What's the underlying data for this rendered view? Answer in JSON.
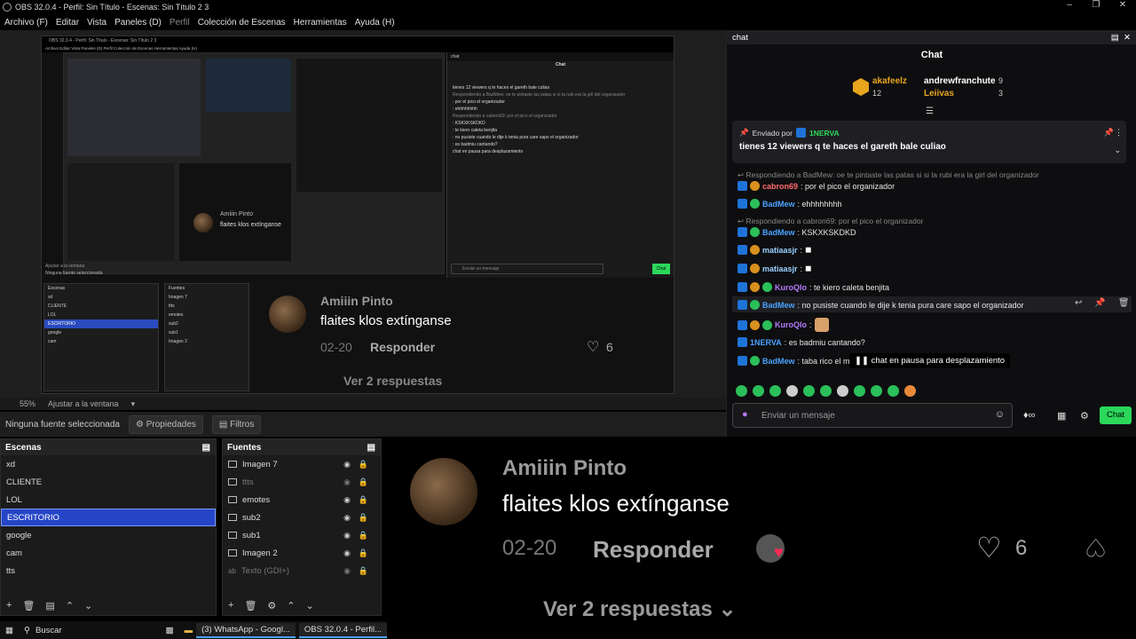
{
  "window": {
    "title": "OBS 32.0.4 - Perfil: Sin Título - Escenas: Sin Título 2 3"
  },
  "menu": [
    "Archivo (F)",
    "Editar",
    "Vista",
    "Paneles (D)",
    "Perfil",
    "Colección de Escenas",
    "Herramientas",
    "Ayuda (H)"
  ],
  "preview": {
    "nested_title": "OBS 32.0.4 - Perfil: Sin Título - Escenas: Sin Título 2 3",
    "nested_menu": "Archivo Editar Vista Paneles (D) Perfil Colección de Escenas Herramientas Ayuda (H)",
    "comment_user": "Amiiin Pinto",
    "comment_text": "flaites klos extínganse",
    "comment_date": "02-20",
    "comment_reply": "Responder",
    "comment_likes": "6",
    "comment_more": "Ver 2 respuestas",
    "small_user": "Amiiin Pinto",
    "small_text": "flaites klos extínganse",
    "small_date": "02-20",
    "small_reply": "Responder",
    "small_likes": "6",
    "small_more": "Ver 2 respuestas ⌄"
  },
  "zoom": {
    "level": "55%",
    "fit": "Ajustar a la ventana"
  },
  "props": {
    "none": "Ninguna fuente seleccionada",
    "properties": "Propiedades",
    "filters": "Filtros"
  },
  "scenes": {
    "title": "Escenas",
    "items": [
      "xd",
      "CLIENTE",
      "LOL",
      "ESCRITORIO",
      "google",
      "cam",
      "tts"
    ]
  },
  "sources": {
    "title": "Fuentes",
    "items": [
      "Imagen 7",
      "ttts",
      "emotes",
      "sub2",
      "sub1",
      "Imagen 2",
      "Texto (GDI+)"
    ]
  },
  "taskbar": {
    "search": "Buscar",
    "whatsapp": "(3) WhatsApp - Googl...",
    "obs": "OBS 32.0.4 - Perfil..."
  },
  "chat": {
    "panel_title": "chat",
    "header": "Chat",
    "top": {
      "u1": "akafeelz",
      "n1": "12",
      "u2": "andrewfranchute",
      "n2": "9",
      "u3": "Leiivas",
      "n3": "3"
    },
    "pinned_by": "Enviado por",
    "pinned_user": "1NERVA",
    "pinned_text": "tienes 12 viewers q te haces el gareth bale culiao",
    "messages": [
      {
        "reply": "Respondiendo a BadMew: oe te pintaste las patas si si la rubi era la girl del organizador"
      },
      {
        "user": "cabron69",
        "text": ": por el pico el organizador",
        "color": "#ff6b6b"
      },
      {
        "user": "BadMew",
        "text": ": ehhhhhhhh",
        "color": "#4aa3ff"
      },
      {
        "reply": "Respondiendo a cabron69: por el pico el organizador"
      },
      {
        "user": "BadMew",
        "text": ": KSKXKSKDKD",
        "color": "#4aa3ff"
      },
      {
        "user": "matiaasjr",
        "text": ":",
        "color": "#9ad0ff"
      },
      {
        "user": "matiaasjr",
        "text": ":",
        "color": "#9ad0ff"
      },
      {
        "user": "KuroQlo",
        "text": ": te kiero caleta benjita",
        "color": "#b57bff"
      },
      {
        "user": "BadMew",
        "text": ": no pusiste cuando le dije k tenia pura care sapo el organizador",
        "color": "#4aa3ff"
      },
      {
        "user": "KuroQlo",
        "text": ":",
        "color": "#b57bff"
      },
      {
        "user": "1NERVA",
        "text": ": es badmiu cantando?",
        "color": "#4aa3ff"
      },
      {
        "user": "BadMew",
        "text": ": taba rico el m",
        "color": "#4aa3ff"
      }
    ],
    "paused": "chat en pausa para desplazamiento",
    "input_placeholder": "Enviar un mensaje",
    "send": "Chat"
  },
  "big_comment": {
    "user": "Amiiin Pinto",
    "text": "flaites klos extínganse",
    "date": "02-20",
    "reply": "Responder",
    "likes": "6",
    "more": "Ver 2 respuestas"
  }
}
